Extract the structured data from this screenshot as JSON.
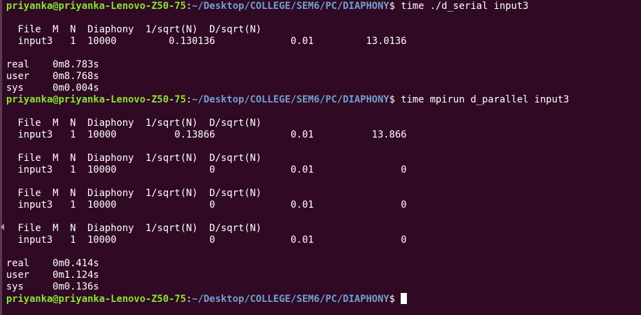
{
  "prompt": {
    "user_host": "priyanka@priyanka-Lenovo-Z50-75",
    "colon": ":",
    "path": "~/Desktop/COLLEGE/SEM6/PC/DIAPHONY",
    "dollar": "$"
  },
  "output": [
    {
      "kind": "prompt",
      "cmd": " time ./d_serial input3"
    },
    {
      "kind": "text",
      "text": ""
    },
    {
      "kind": "text",
      "text": "  File  M  N  Diaphony  1/sqrt(N)  D/sqrt(N)"
    },
    {
      "kind": "text",
      "text": "  input3   1  10000         0.130136             0.01         13.0136"
    },
    {
      "kind": "text",
      "text": ""
    },
    {
      "kind": "text",
      "text": "real    0m8.783s"
    },
    {
      "kind": "text",
      "text": "user    0m8.768s"
    },
    {
      "kind": "text",
      "text": "sys     0m0.004s"
    },
    {
      "kind": "prompt",
      "cmd": " time mpirun d_parallel input3"
    },
    {
      "kind": "text",
      "text": ""
    },
    {
      "kind": "text",
      "text": "  File  M  N  Diaphony  1/sqrt(N)  D/sqrt(N)"
    },
    {
      "kind": "text",
      "text": "  input3   1  10000          0.13866             0.01          13.866"
    },
    {
      "kind": "text",
      "text": ""
    },
    {
      "kind": "text",
      "text": "  File  M  N  Diaphony  1/sqrt(N)  D/sqrt(N)"
    },
    {
      "kind": "text",
      "text": "  input3   1  10000                0             0.01               0"
    },
    {
      "kind": "text",
      "text": ""
    },
    {
      "kind": "text",
      "text": "  File  M  N  Diaphony  1/sqrt(N)  D/sqrt(N)"
    },
    {
      "kind": "text",
      "text": "  input3   1  10000                0             0.01               0"
    },
    {
      "kind": "text",
      "text": ""
    },
    {
      "kind": "text",
      "text": "  File  M  N  Diaphony  1/sqrt(N)  D/sqrt(N)"
    },
    {
      "kind": "text",
      "text": "  input3   1  10000                0             0.01               0"
    },
    {
      "kind": "text",
      "text": ""
    },
    {
      "kind": "text",
      "text": "real    0m0.414s"
    },
    {
      "kind": "text",
      "text": "user    0m1.124s"
    },
    {
      "kind": "text",
      "text": "sys     0m0.136s"
    },
    {
      "kind": "prompt",
      "cmd": " ",
      "cursor": true
    }
  ],
  "colors": {
    "background": "#300a24",
    "user_host": "#8ae234",
    "path": "#729fcf",
    "text": "#ffffff"
  },
  "icons": {
    "scroll_indicator": "left-arrow-icon"
  }
}
